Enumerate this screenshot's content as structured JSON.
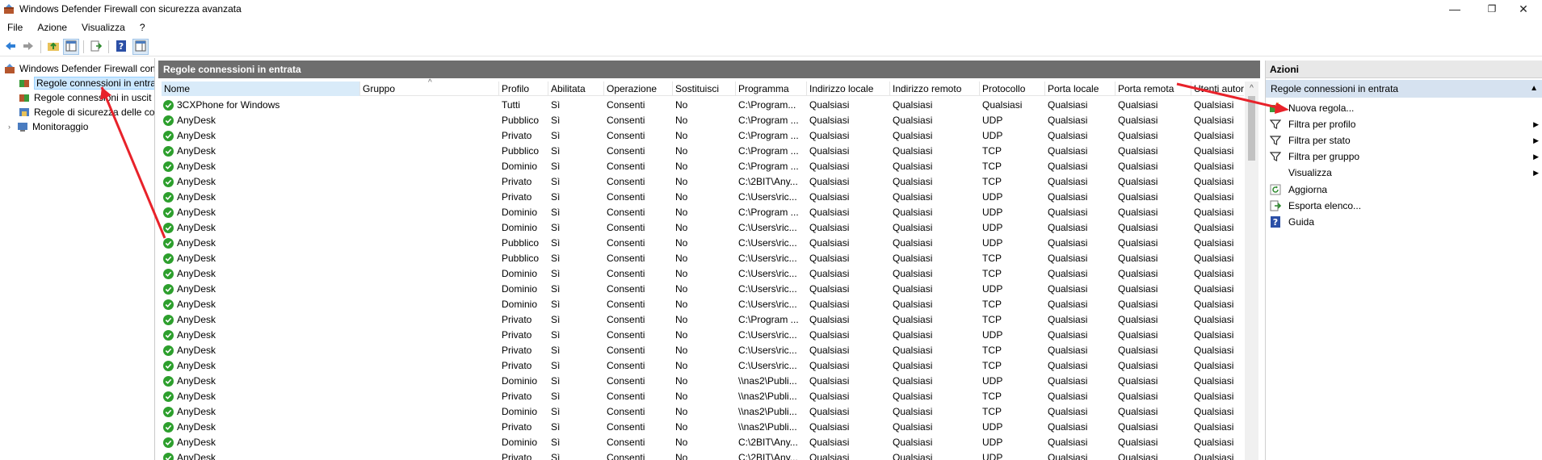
{
  "window": {
    "title": "Windows Defender Firewall con sicurezza avanzata",
    "controls": [
      "—",
      "❐",
      "✕"
    ]
  },
  "menu": [
    "File",
    "Azione",
    "Visualizza",
    "?"
  ],
  "tree": {
    "root": "Windows Defender Firewall con",
    "items": [
      "Regole connessioni in entra",
      "Regole connessioni in uscit",
      "Regole di sicurezza delle co",
      "Monitoraggio"
    ]
  },
  "center": {
    "header": "Regole connessioni in entrata",
    "columns": [
      "Nome",
      "Gruppo",
      "Profilo",
      "Abilitata",
      "Operazione",
      "Sostituisci",
      "Programma",
      "Indirizzo locale",
      "Indirizzo remoto",
      "Protocollo",
      "Porta locale",
      "Porta remota",
      "Utenti autor"
    ],
    "rows": [
      [
        "3CXPhone for Windows",
        "",
        "Tutti",
        "Sì",
        "Consenti",
        "No",
        "C:\\Program...",
        "Qualsiasi",
        "Qualsiasi",
        "Qualsiasi",
        "Qualsiasi",
        "Qualsiasi",
        "Qualsiasi"
      ],
      [
        "AnyDesk",
        "",
        "Pubblico",
        "Sì",
        "Consenti",
        "No",
        "C:\\Program ...",
        "Qualsiasi",
        "Qualsiasi",
        "UDP",
        "Qualsiasi",
        "Qualsiasi",
        "Qualsiasi"
      ],
      [
        "AnyDesk",
        "",
        "Privato",
        "Sì",
        "Consenti",
        "No",
        "C:\\Program ...",
        "Qualsiasi",
        "Qualsiasi",
        "UDP",
        "Qualsiasi",
        "Qualsiasi",
        "Qualsiasi"
      ],
      [
        "AnyDesk",
        "",
        "Pubblico",
        "Sì",
        "Consenti",
        "No",
        "C:\\Program ...",
        "Qualsiasi",
        "Qualsiasi",
        "TCP",
        "Qualsiasi",
        "Qualsiasi",
        "Qualsiasi"
      ],
      [
        "AnyDesk",
        "",
        "Dominio",
        "Sì",
        "Consenti",
        "No",
        "C:\\Program ...",
        "Qualsiasi",
        "Qualsiasi",
        "TCP",
        "Qualsiasi",
        "Qualsiasi",
        "Qualsiasi"
      ],
      [
        "AnyDesk",
        "",
        "Privato",
        "Sì",
        "Consenti",
        "No",
        "C:\\2BIT\\Any...",
        "Qualsiasi",
        "Qualsiasi",
        "TCP",
        "Qualsiasi",
        "Qualsiasi",
        "Qualsiasi"
      ],
      [
        "AnyDesk",
        "",
        "Privato",
        "Sì",
        "Consenti",
        "No",
        "C:\\Users\\ric...",
        "Qualsiasi",
        "Qualsiasi",
        "UDP",
        "Qualsiasi",
        "Qualsiasi",
        "Qualsiasi"
      ],
      [
        "AnyDesk",
        "",
        "Dominio",
        "Sì",
        "Consenti",
        "No",
        "C:\\Program ...",
        "Qualsiasi",
        "Qualsiasi",
        "UDP",
        "Qualsiasi",
        "Qualsiasi",
        "Qualsiasi"
      ],
      [
        "AnyDesk",
        "",
        "Dominio",
        "Sì",
        "Consenti",
        "No",
        "C:\\Users\\ric...",
        "Qualsiasi",
        "Qualsiasi",
        "UDP",
        "Qualsiasi",
        "Qualsiasi",
        "Qualsiasi"
      ],
      [
        "AnyDesk",
        "",
        "Pubblico",
        "Sì",
        "Consenti",
        "No",
        "C:\\Users\\ric...",
        "Qualsiasi",
        "Qualsiasi",
        "UDP",
        "Qualsiasi",
        "Qualsiasi",
        "Qualsiasi"
      ],
      [
        "AnyDesk",
        "",
        "Pubblico",
        "Sì",
        "Consenti",
        "No",
        "C:\\Users\\ric...",
        "Qualsiasi",
        "Qualsiasi",
        "TCP",
        "Qualsiasi",
        "Qualsiasi",
        "Qualsiasi"
      ],
      [
        "AnyDesk",
        "",
        "Dominio",
        "Sì",
        "Consenti",
        "No",
        "C:\\Users\\ric...",
        "Qualsiasi",
        "Qualsiasi",
        "TCP",
        "Qualsiasi",
        "Qualsiasi",
        "Qualsiasi"
      ],
      [
        "AnyDesk",
        "",
        "Dominio",
        "Sì",
        "Consenti",
        "No",
        "C:\\Users\\ric...",
        "Qualsiasi",
        "Qualsiasi",
        "UDP",
        "Qualsiasi",
        "Qualsiasi",
        "Qualsiasi"
      ],
      [
        "AnyDesk",
        "",
        "Dominio",
        "Sì",
        "Consenti",
        "No",
        "C:\\Users\\ric...",
        "Qualsiasi",
        "Qualsiasi",
        "TCP",
        "Qualsiasi",
        "Qualsiasi",
        "Qualsiasi"
      ],
      [
        "AnyDesk",
        "",
        "Privato",
        "Sì",
        "Consenti",
        "No",
        "C:\\Program ...",
        "Qualsiasi",
        "Qualsiasi",
        "TCP",
        "Qualsiasi",
        "Qualsiasi",
        "Qualsiasi"
      ],
      [
        "AnyDesk",
        "",
        "Privato",
        "Sì",
        "Consenti",
        "No",
        "C:\\Users\\ric...",
        "Qualsiasi",
        "Qualsiasi",
        "UDP",
        "Qualsiasi",
        "Qualsiasi",
        "Qualsiasi"
      ],
      [
        "AnyDesk",
        "",
        "Privato",
        "Sì",
        "Consenti",
        "No",
        "C:\\Users\\ric...",
        "Qualsiasi",
        "Qualsiasi",
        "TCP",
        "Qualsiasi",
        "Qualsiasi",
        "Qualsiasi"
      ],
      [
        "AnyDesk",
        "",
        "Privato",
        "Sì",
        "Consenti",
        "No",
        "C:\\Users\\ric...",
        "Qualsiasi",
        "Qualsiasi",
        "TCP",
        "Qualsiasi",
        "Qualsiasi",
        "Qualsiasi"
      ],
      [
        "AnyDesk",
        "",
        "Dominio",
        "Sì",
        "Consenti",
        "No",
        "\\\\nas2\\Publi...",
        "Qualsiasi",
        "Qualsiasi",
        "UDP",
        "Qualsiasi",
        "Qualsiasi",
        "Qualsiasi"
      ],
      [
        "AnyDesk",
        "",
        "Privato",
        "Sì",
        "Consenti",
        "No",
        "\\\\nas2\\Publi...",
        "Qualsiasi",
        "Qualsiasi",
        "TCP",
        "Qualsiasi",
        "Qualsiasi",
        "Qualsiasi"
      ],
      [
        "AnyDesk",
        "",
        "Dominio",
        "Sì",
        "Consenti",
        "No",
        "\\\\nas2\\Publi...",
        "Qualsiasi",
        "Qualsiasi",
        "TCP",
        "Qualsiasi",
        "Qualsiasi",
        "Qualsiasi"
      ],
      [
        "AnyDesk",
        "",
        "Privato",
        "Sì",
        "Consenti",
        "No",
        "\\\\nas2\\Publi...",
        "Qualsiasi",
        "Qualsiasi",
        "UDP",
        "Qualsiasi",
        "Qualsiasi",
        "Qualsiasi"
      ],
      [
        "AnyDesk",
        "",
        "Dominio",
        "Sì",
        "Consenti",
        "No",
        "C:\\2BIT\\Any...",
        "Qualsiasi",
        "Qualsiasi",
        "UDP",
        "Qualsiasi",
        "Qualsiasi",
        "Qualsiasi"
      ],
      [
        "AnyDesk",
        "",
        "Privato",
        "Sì",
        "Consenti",
        "No",
        "C:\\2BIT\\Any...",
        "Qualsiasi",
        "Qualsiasi",
        "UDP",
        "Qualsiasi",
        "Qualsiasi",
        "Qualsiasi"
      ]
    ]
  },
  "actions": {
    "header": "Azioni",
    "section": "Regole connessioni in entrata",
    "items": [
      {
        "label": "Nuova regola...",
        "icon": "new-rule-icon",
        "submenu": false
      },
      {
        "label": "Filtra per profilo",
        "icon": "filter-icon",
        "submenu": true
      },
      {
        "label": "Filtra per stato",
        "icon": "filter-icon",
        "submenu": true
      },
      {
        "label": "Filtra per gruppo",
        "icon": "filter-icon",
        "submenu": true
      },
      {
        "label": "Visualizza",
        "icon": "",
        "submenu": true
      },
      {
        "label": "Aggiorna",
        "icon": "refresh-icon",
        "submenu": false
      },
      {
        "label": "Esporta elenco...",
        "icon": "export-icon",
        "submenu": false
      },
      {
        "label": "Guida",
        "icon": "help-icon",
        "submenu": false
      }
    ]
  },
  "colors": {
    "panel_header": "#6e6e6e",
    "action_section": "#d6e2f0",
    "selection": "#cce8ff",
    "enabled_check": "#2d9f2d",
    "annotation": "#e8222a"
  }
}
